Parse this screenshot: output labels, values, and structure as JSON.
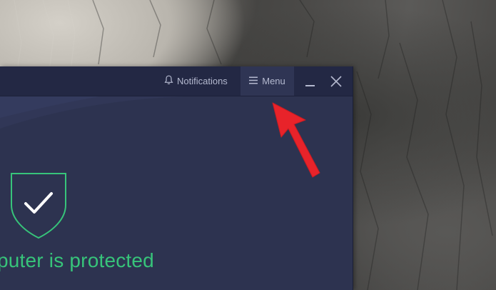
{
  "titlebar": {
    "notifications_label": "Notifications",
    "menu_label": "Menu"
  },
  "main": {
    "status_text": "puter is protected"
  },
  "icons": {
    "notifications": "bell-icon",
    "menu": "hamburger-icon",
    "minimize": "minimize-icon",
    "close": "close-icon",
    "shield": "shield-check-icon",
    "annotation": "red-arrow-annotation"
  },
  "colors": {
    "window_bg": "#2d3350",
    "titlebar_bg": "#232844",
    "menu_bg": "#2f3554",
    "text_muted": "#b4b9cf",
    "success_green": "#37c47a",
    "arrow_red": "#e8232a"
  }
}
